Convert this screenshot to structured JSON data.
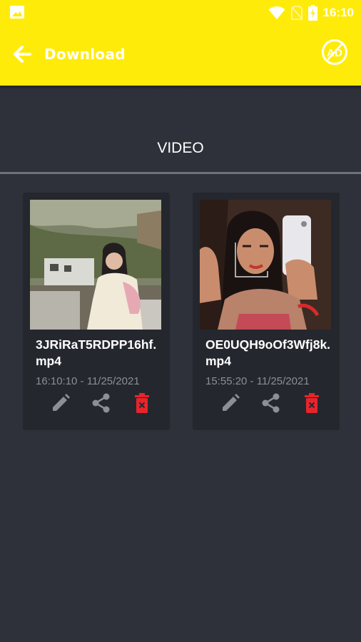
{
  "status_bar": {
    "time": "16:10",
    "icons": [
      "image-notification-icon",
      "wifi-icon",
      "no-sim-icon",
      "battery-charging-icon"
    ]
  },
  "app_bar": {
    "title": "Download",
    "back_icon": "arrow-left-icon",
    "action_icon": "no-ads-icon",
    "action_icon_text": "AD",
    "background_color": "#ffeb0a"
  },
  "tab": {
    "label": "VIDEO"
  },
  "videos": [
    {
      "filename": "3JRiRaT5RDPP16hf.mp4",
      "datetime": "16:10:10 - 11/25/2021",
      "actions": [
        "edit-icon",
        "share-icon",
        "delete-icon"
      ]
    },
    {
      "filename": "OE0UQH9oOf3Wfj8k.mp4",
      "datetime": "15:55:20 - 11/25/2021",
      "actions": [
        "edit-icon",
        "share-icon",
        "delete-icon"
      ]
    }
  ],
  "colors": {
    "background": "#2e313a",
    "card": "#25272e",
    "delete": "#e8242b",
    "icon_gray": "#8c8f97"
  }
}
